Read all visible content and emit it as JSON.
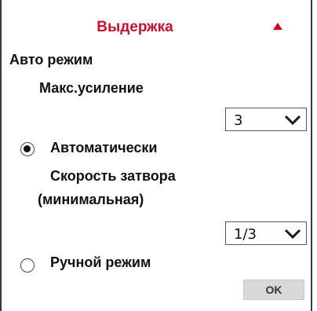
{
  "panel": {
    "title": "Выдержка",
    "collapse_icon": "triangle-up-icon",
    "accent_color": "#c8102e"
  },
  "auto_mode": {
    "label": "Авто режим",
    "max_gain_label": "Макс.усиление",
    "max_gain_value": "3"
  },
  "automatic": {
    "label": "Автоматически",
    "selected": true,
    "shutter_label_line1": "Скорость затвора",
    "shutter_label_line2": "(минимальная)",
    "shutter_value": "1/3"
  },
  "manual": {
    "label": "Ручной режим",
    "selected": false
  },
  "actions": {
    "ok_label": "OK"
  }
}
